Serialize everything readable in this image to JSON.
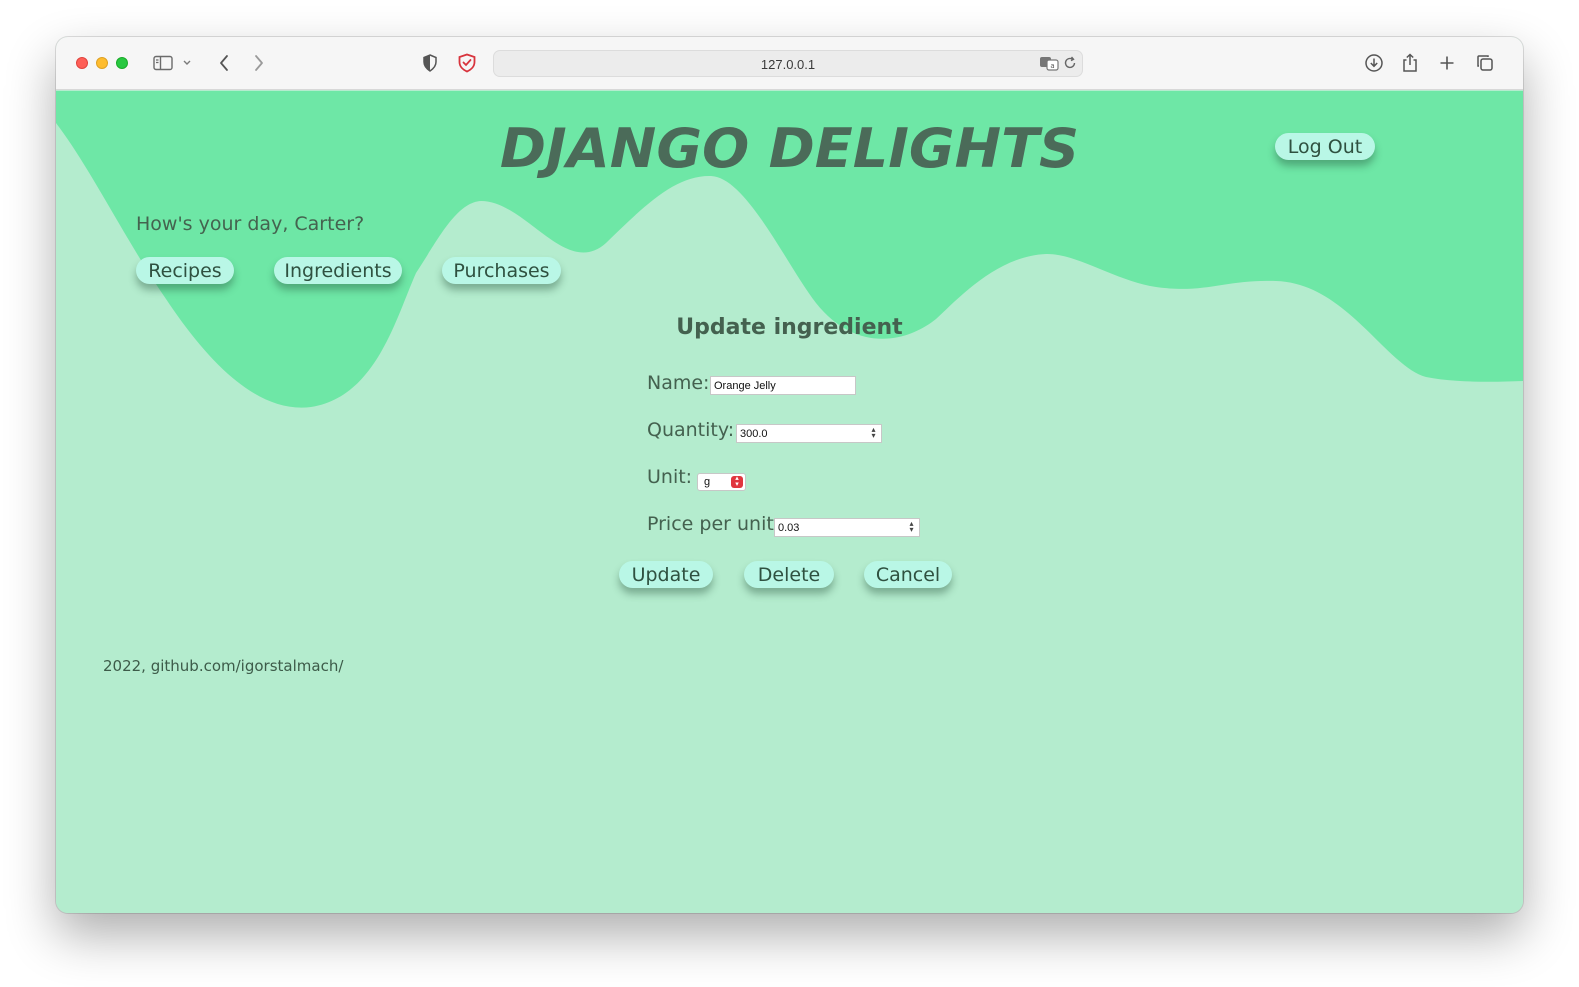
{
  "browser": {
    "url": "127.0.0.1"
  },
  "site": {
    "title": "DJANGO DELIGHTS",
    "logout_label": "Log Out",
    "greeting": "How's your day, Carter?",
    "nav": [
      {
        "label": "Recipes"
      },
      {
        "label": "Ingredients"
      },
      {
        "label": "Purchases"
      }
    ]
  },
  "form": {
    "title": "Update ingredient",
    "name_label": "Name:",
    "name_value": "Orange Jelly",
    "quantity_label": "Quantity:",
    "quantity_value": "300.0",
    "unit_label": "Unit:",
    "unit_value": "g",
    "price_label": "Price per unit:",
    "price_value": "0.03",
    "update_label": "Update",
    "delete_label": "Delete",
    "cancel_label": "Cancel"
  },
  "footer": {
    "text": "2022, github.com/igorstalmach/"
  },
  "colors": {
    "header_green": "#6ee7a6",
    "page_green": "#b4ecce",
    "button_bg": "#b9f7e6",
    "text_dark": "#44614f"
  }
}
